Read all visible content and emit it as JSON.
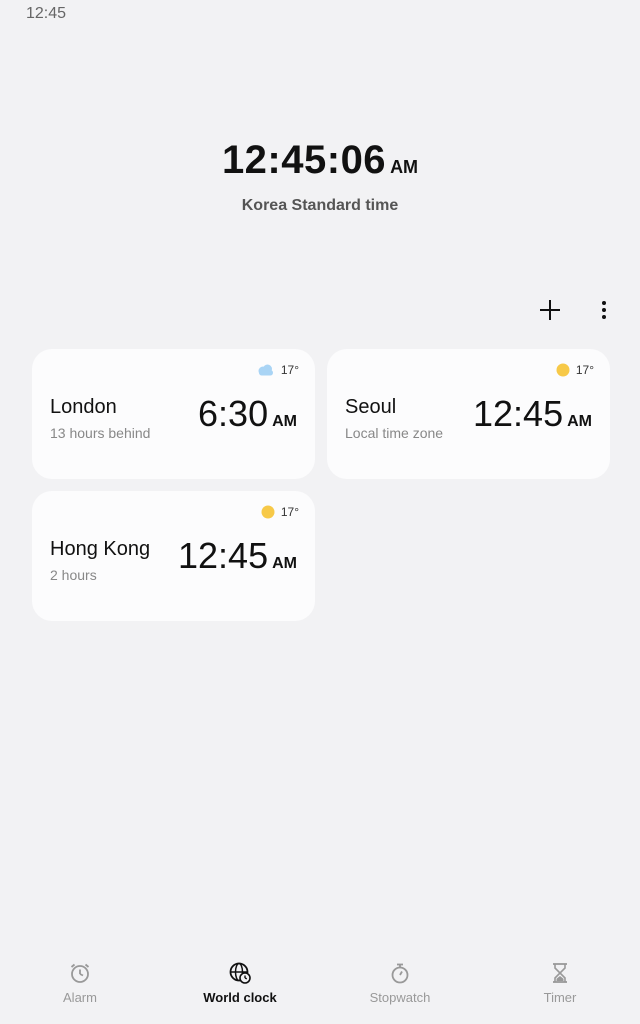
{
  "status_bar": {
    "time": "12:45"
  },
  "main_clock": {
    "time": "12:45:06",
    "ampm": "AM",
    "timezone": "Korea Standard time"
  },
  "actions": {
    "add_icon": "plus-icon",
    "more_icon": "more-vert-icon"
  },
  "cities": [
    {
      "name": "London",
      "diff": "13 hours behind",
      "time": "6:30",
      "ampm": "AM",
      "temp": "17°",
      "weather_icon": "cloud-icon"
    },
    {
      "name": "Seoul",
      "diff": "Local time zone",
      "time": "12:45",
      "ampm": "AM",
      "temp": "17°",
      "weather_icon": "sun-icon"
    },
    {
      "name": "Hong Kong",
      "diff": "2 hours",
      "time": "12:45",
      "ampm": "AM",
      "temp": "17°",
      "weather_icon": "sun-icon"
    }
  ],
  "nav": [
    {
      "label": "Alarm",
      "icon": "alarm-clock-icon",
      "active": false
    },
    {
      "label": "World clock",
      "icon": "globe-clock-icon",
      "active": true
    },
    {
      "label": "Stopwatch",
      "icon": "stopwatch-icon",
      "active": false
    },
    {
      "label": "Timer",
      "icon": "hourglass-icon",
      "active": false
    }
  ],
  "colors": {
    "background": "#f2f2f4",
    "card": "#fcfcfd",
    "sun": "#f7c948",
    "cloud": "#a9d4f5"
  }
}
